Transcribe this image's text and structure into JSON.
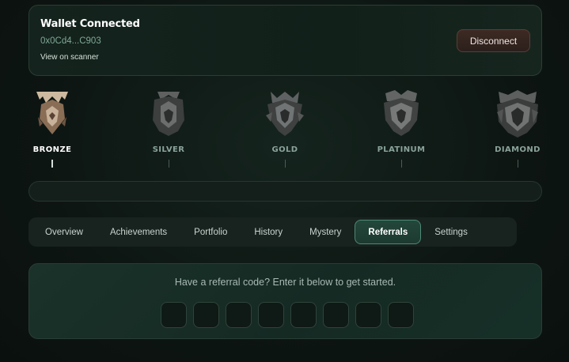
{
  "wallet": {
    "title": "Wallet Connected",
    "address": "0x0Cd4...C903",
    "scanner_link": "View on scanner",
    "disconnect_label": "Disconnect"
  },
  "tiers": [
    {
      "name": "BRONZE",
      "icon": "bronze-crest-icon",
      "active": true,
      "color": "#b9a58f"
    },
    {
      "name": "SILVER",
      "icon": "silver-crest-icon",
      "active": false,
      "color": "#6d6f6e"
    },
    {
      "name": "GOLD",
      "icon": "gold-crest-icon",
      "active": false,
      "color": "#707070"
    },
    {
      "name": "PLATINUM",
      "icon": "platinum-crest-icon",
      "active": false,
      "color": "#6e6e6e"
    },
    {
      "name": "DIAMOND",
      "icon": "diamond-crest-icon",
      "active": false,
      "color": "#6a6a6a"
    }
  ],
  "progress": {
    "fraction": 0
  },
  "tabs": [
    {
      "label": "Overview",
      "active": false
    },
    {
      "label": "Achievements",
      "active": false
    },
    {
      "label": "Portfolio",
      "active": false
    },
    {
      "label": "History",
      "active": false
    },
    {
      "label": "Mystery",
      "active": false
    },
    {
      "label": "Referrals",
      "active": true
    },
    {
      "label": "Settings",
      "active": false
    }
  ],
  "referral": {
    "prompt": "Have a referral code? Enter it below to get started.",
    "code_length": 8
  },
  "colors": {
    "accent": "#4d8a74",
    "background": "#0d1512",
    "danger": "#3d2a24"
  }
}
